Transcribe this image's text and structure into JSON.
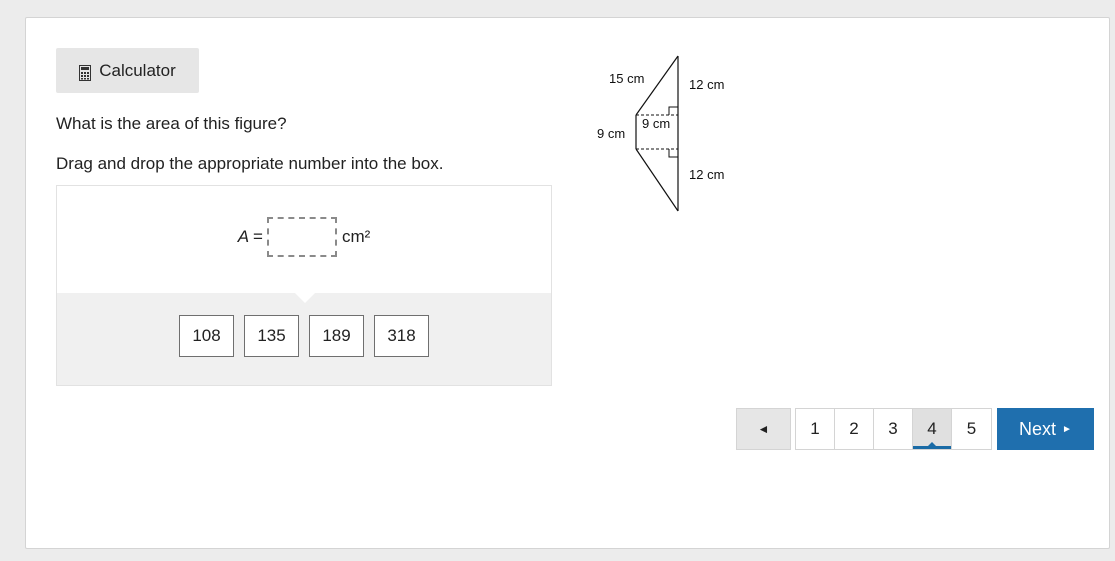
{
  "toolbar": {
    "calculator_label": "Calculator",
    "calculator_icon": "calculator-icon"
  },
  "question": {
    "prompt": "What is the area of this figure?",
    "instruction": "Drag and drop the appropriate number into the box."
  },
  "equation": {
    "variable": "A",
    "equals": "=",
    "unit": "cm²"
  },
  "answer_choices": [
    "108",
    "135",
    "189",
    "318"
  ],
  "figure": {
    "labels": {
      "slant_side": "15 cm",
      "top_segment": "12 cm",
      "left_side": "9 cm",
      "middle_height": "9 cm",
      "bottom_segment": "12 cm"
    }
  },
  "pagination": {
    "prev_icon": "◄",
    "pages": [
      "1",
      "2",
      "3",
      "4",
      "5"
    ],
    "active_page": "4",
    "next_label": "Next",
    "next_icon": "►"
  },
  "colors": {
    "accent": "#1f6fae",
    "panel_bg": "#f0f0f0",
    "page_bg": "#ececec"
  }
}
